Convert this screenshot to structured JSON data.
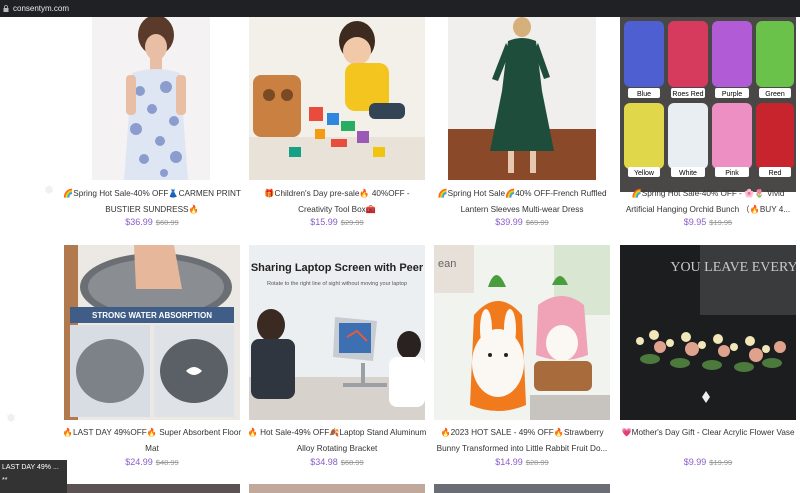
{
  "browser": {
    "url": "consentym.com"
  },
  "products": [
    {
      "title": "🌈Spring Hot Sale-40% OFF👗CARMEN PRINT BUSTIER SUNDRESS🔥",
      "price": "$36.99",
      "old_price": "$60.99"
    },
    {
      "title": "🎁Children's Day pre-sale🔥 40%OFF - Creativity Tool Box🧰",
      "price": "$15.99",
      "old_price": "$29.99"
    },
    {
      "title": "🌈Spring Hot Sale🌈40% OFF-French Ruffled Lantern Sleeves Multi-wear Dress",
      "price": "$39.99",
      "old_price": "$69.99"
    },
    {
      "title": "🌈Spring Hot Sale-40% OFF - 🌸🌷 Vivid Artificial Hanging Orchid Bunch （🔥BUY 4...",
      "price": "$9.95",
      "old_price": "$19.95"
    },
    {
      "title": "🔥LAST DAY 49%OFF🔥 Super Absorbent Floor Mat",
      "price": "$24.99",
      "old_price": "$48.99"
    },
    {
      "title": "🔥 Hot Sale-49% OFF🍂Laptop Stand Aluminum Alloy Rotating Bracket",
      "price": "$34.98",
      "old_price": "$68.99"
    },
    {
      "title": "🔥2023 HOT SALE - 49% OFF🔥Strawberry Bunny Transformed into Little Rabbit Fruit Do...",
      "price": "$14.99",
      "old_price": "$28.99"
    },
    {
      "title": "💗Mother's Day Gift - Clear Acrylic Flower Vase",
      "price": "$9.99",
      "old_price": "$19.99"
    }
  ],
  "image_text": {
    "orchid_labels": [
      "Blue",
      "Roes Red",
      "Purple",
      "Green",
      "Yellow",
      "White",
      "Pink",
      "Red"
    ],
    "mat_banner": "STRONG WATER ABSORPTION",
    "laptop_heading": "Sharing Laptop Screen with Peer",
    "laptop_sub": "Rotate to the right line of sight without moving your laptop",
    "vase_sign": "YOU LEAVE EVERY DAY",
    "strawberry_sign": "ean"
  },
  "toast": {
    "line1": "LAST DAY 49% ...",
    "line2": "**"
  },
  "colors": {
    "price": "#8a5cc9",
    "old_price": "#999999",
    "topbar": "#202124"
  }
}
